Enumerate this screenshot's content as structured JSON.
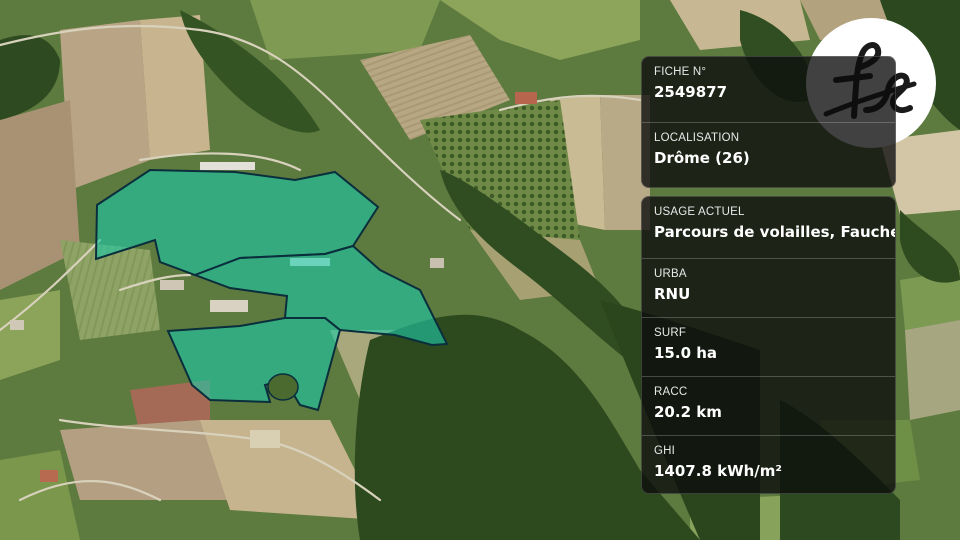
{
  "map": {
    "parcel_fill": "#1fc8a6",
    "parcel_outline": "#0a2e3c",
    "background": "satellite"
  },
  "logo": {
    "text": "fs",
    "icon": "fs-monogram-icon"
  },
  "card_top": {
    "fiche_label": "FICHE N°",
    "fiche_value": "2549877",
    "localisation_label": "LOCALISATION",
    "localisation_value": "Drôme (26)"
  },
  "card_bottom": {
    "usage_label": "USAGE ACTUEL",
    "usage_value": "Parcours de volailles, Fauche",
    "urba_label": "URBA",
    "urba_value": "RNU",
    "surf_label": "SURF",
    "surf_value": "15.0 ha",
    "racc_label": "RACC",
    "racc_value": "20.2 km",
    "ghi_label": "GHI",
    "ghi_value": "1407.8 kWh/m²"
  }
}
